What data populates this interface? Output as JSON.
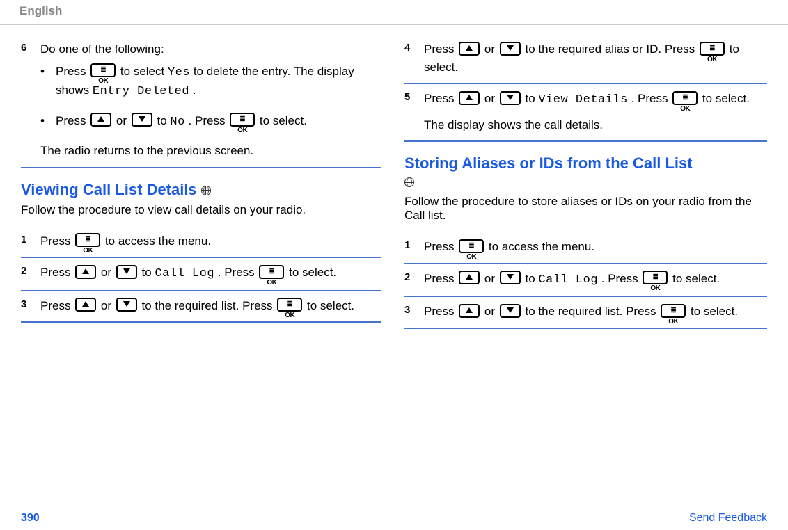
{
  "header": {
    "language": "English"
  },
  "left": {
    "step6": {
      "num": "6",
      "lead": "Do one of the following:",
      "bullet1_a": "Press ",
      "bullet1_b": " to select ",
      "bullet1_yes": "Yes",
      "bullet1_c": " to delete the entry. The display shows ",
      "bullet1_deleted": "Entry Deleted",
      "bullet1_d": ".",
      "bullet2_a": "Press ",
      "bullet2_b": " or ",
      "bullet2_c": " to ",
      "bullet2_no": "No",
      "bullet2_d": ". Press ",
      "bullet2_e": " to select.",
      "return": "The radio returns to the previous screen."
    },
    "sectionA": {
      "title": "Viewing Call List Details ",
      "intro": "Follow the procedure to view call details on your radio.",
      "s1": {
        "num": "1",
        "a": "Press ",
        "b": " to access the menu."
      },
      "s2": {
        "num": "2",
        "a": "Press ",
        "b": " or ",
        "c": " to ",
        "calllog": "Call Log",
        "d": ". Press ",
        "e": " to select."
      },
      "s3": {
        "num": "3",
        "a": "Press ",
        "b": " or ",
        "c": " to the required list. Press ",
        "d": " to select."
      }
    }
  },
  "right": {
    "s4": {
      "num": "4",
      "a": "Press ",
      "b": " or ",
      "c": " to the required alias or ID. Press ",
      "d": " to select."
    },
    "s5": {
      "num": "5",
      "a": "Press ",
      "b": " or ",
      "c": " to ",
      "vd": "View Details",
      "d": ". Press ",
      "e": " to select.",
      "tail": "The display shows the call details."
    },
    "sectionB": {
      "title": "Storing Aliases or IDs from the Call List",
      "intro": "Follow the procedure to store aliases or IDs on your radio from the Call list.",
      "s1": {
        "num": "1",
        "a": "Press ",
        "b": " to access the menu."
      },
      "s2": {
        "num": "2",
        "a": "Press ",
        "b": " or ",
        "c": " to ",
        "calllog": "Call Log",
        "d": ". Press ",
        "e": " to select."
      },
      "s3": {
        "num": "3",
        "a": "Press ",
        "b": " or ",
        "c": " to the required list. Press ",
        "d": " to select."
      }
    }
  },
  "footer": {
    "page": "390",
    "feedback": "Send Feedback"
  },
  "buttons": {
    "ok": "≣ OK"
  }
}
